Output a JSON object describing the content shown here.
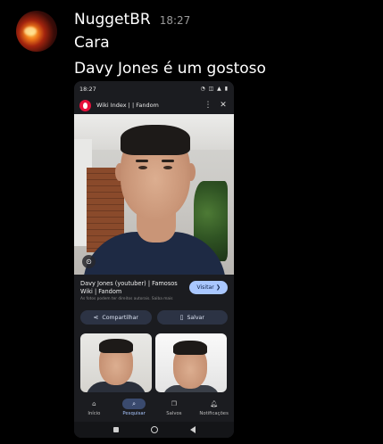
{
  "message": {
    "username": "NuggetBR",
    "timestamp": "18:27",
    "lines": [
      "Cara",
      "Davy Jones é um gostoso"
    ]
  },
  "phone": {
    "status_time": "18:27",
    "status_icons": "◔ ◫ ▲ ▮",
    "page_title": "Wiki Index | | Fandom",
    "menu_icon": "⋮",
    "close_icon": "✕",
    "lens_icon": "⊙",
    "result": {
      "title": "Davy Jones (youtuber) | Famosos Wiki | Fandom",
      "note": "As fotos podem ter direitos autorais. Saiba mais",
      "visit_label": "Visitar ❯"
    },
    "actions": [
      {
        "icon": "⋖",
        "label": "Compartilhar"
      },
      {
        "icon": "▯",
        "label": "Salvar"
      }
    ],
    "nav": [
      {
        "icon": "⌂",
        "label": "Início"
      },
      {
        "icon": "⌕",
        "label": "Pesquisar"
      },
      {
        "icon": "❐",
        "label": "Salvos"
      },
      {
        "icon": "🔔︎",
        "label": "Notificações"
      }
    ]
  },
  "colors": {
    "background": "#000000",
    "fandom_red": "#e8103c",
    "visit_button": "#a9c7ff",
    "active_nav": "#3a4a6e"
  }
}
